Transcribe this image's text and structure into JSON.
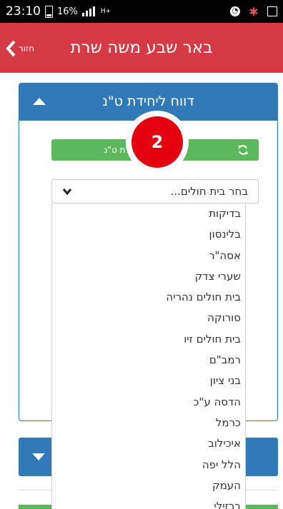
{
  "status_bar": {
    "time": "23:10",
    "battery_percent": "16%",
    "network": "H+"
  },
  "header": {
    "title": "באר שבע משה שרת",
    "back_label": "חזור",
    "background_color": "#d63a45"
  },
  "report_card": {
    "title": "דווח ליחידת ט\"נ",
    "refresh_button_label": "דת ט\"נ",
    "refresh_icon": "refresh-icon",
    "header_color": "#2f7ab7"
  },
  "step_badge": {
    "number": "2",
    "color": "#e3000f"
  },
  "hospital_select": {
    "value": "בחר בית חולים..."
  },
  "hospital_options": [
    "בדיקות",
    "בלינסון",
    "אסה\"ר",
    "שערי צדק",
    "בית חולים נהריה",
    "סורוקה",
    "בית חולים זיו",
    "רמב\"ם",
    "בני ציון",
    "הדסה ע\"כ",
    "כרמל",
    "איכילוב",
    "הלל יפה",
    "העמק",
    "ברזילי"
  ]
}
